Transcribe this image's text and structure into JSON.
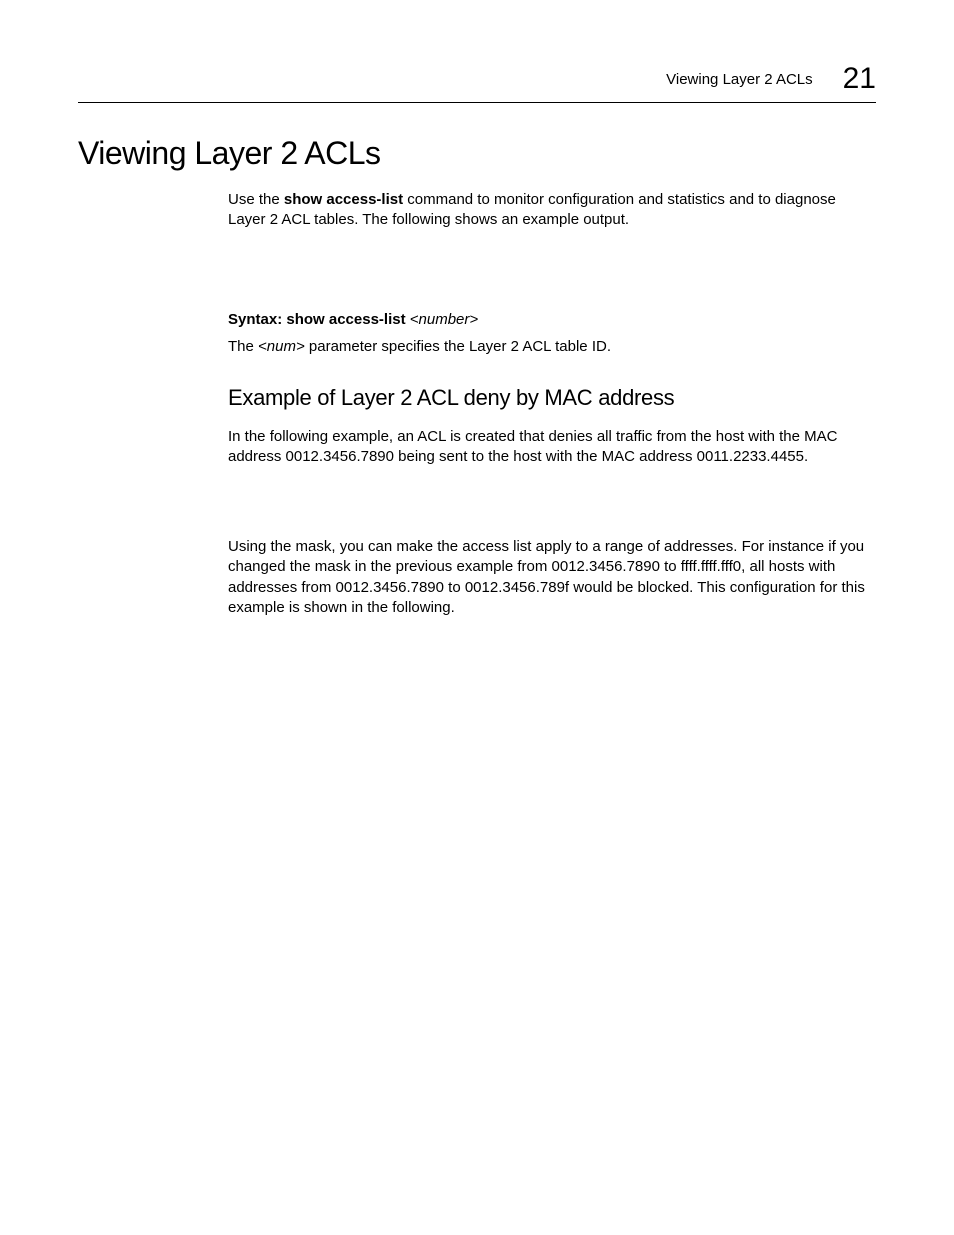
{
  "header": {
    "title": "Viewing Layer 2 ACLs",
    "chapter_number": "21"
  },
  "content": {
    "h1": "Viewing Layer 2 ACLs",
    "intro_pre": "Use the ",
    "intro_cmd": "show access-list",
    "intro_post": " command to monitor configuration and statistics and to diagnose Layer 2 ACL tables.  The following shows an example output.",
    "syntax_label": "Syntax:  show access-list ",
    "syntax_param": "<number>",
    "param_pre": "The ",
    "param_num": "<num>",
    "param_post": " parameter specifies the Layer 2 ACL table ID.",
    "h2": "Example of Layer 2 ACL deny by MAC address",
    "example_para1": "In the following example, an ACL is created that denies all traffic from the host with the MAC address 0012.3456.7890 being sent to the host with the MAC address 0011.2233.4455.",
    "example_para2": "Using the mask, you can make the access list apply to a range of addresses. For instance if you changed the mask in the previous example from 0012.3456.7890 to ffff.ffff.fff0, all hosts with addresses from 0012.3456.7890 to 0012.3456.789f would be blocked. This configuration for this example is shown in the following."
  }
}
